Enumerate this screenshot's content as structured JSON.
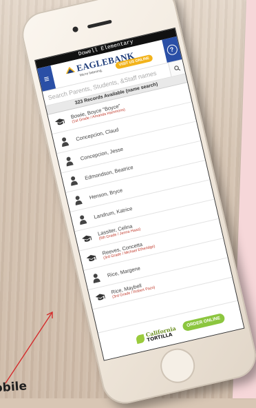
{
  "page": {
    "annotation_text": "obile"
  },
  "app": {
    "school_title": "Dowell Elementary",
    "brand_name": "EAGLEBANK",
    "brand_tagline": "We're listening.",
    "visit_button": "VISIT US ONLINE",
    "help_icon_label": "?"
  },
  "search": {
    "placeholder": "Search Parents, Students, &Staff names"
  },
  "records": {
    "summary": "323 Records Available (name search)"
  },
  "list": [
    {
      "name": "Bowie, Boyce \"Boyce\"",
      "detail": "(1st Grade / Amanda Hammons)",
      "icon": "graduation-cap-icon"
    },
    {
      "name": "Concepcion, Claud",
      "detail": "",
      "icon": "person-icon"
    },
    {
      "name": "Concepcion, Jesse",
      "detail": "",
      "icon": "person-icon"
    },
    {
      "name": "Edmondson, Beatrice",
      "detail": "",
      "icon": "person-icon"
    },
    {
      "name": "Henson, Bryce",
      "detail": "",
      "icon": "person-icon"
    },
    {
      "name": "Landrum, Katrice",
      "detail": "",
      "icon": "person-icon"
    },
    {
      "name": "Lassiter, Celina",
      "detail": "(5th Grade / Jenna Haas)",
      "icon": "graduation-cap-icon"
    },
    {
      "name": "Reeves, Concetta",
      "detail": "(3rd Grade / Michael Etheridge)",
      "icon": "graduation-cap-icon"
    },
    {
      "name": "Rice, Margene",
      "detail": "",
      "icon": "person-icon"
    },
    {
      "name": "Rice, Maybell",
      "detail": "(3rd Grade / Robert Pazo)",
      "icon": "graduation-cap-icon"
    }
  ],
  "footer": {
    "sponsor_line1": "California",
    "sponsor_line2": "TORTILLA",
    "order_button": "ORDER ONLINE"
  },
  "colors": {
    "brand_blue": "#2a4fa6",
    "visit_button": "#f2b31b",
    "detail_red": "#c0392b",
    "order_green": "#8cc63f"
  }
}
